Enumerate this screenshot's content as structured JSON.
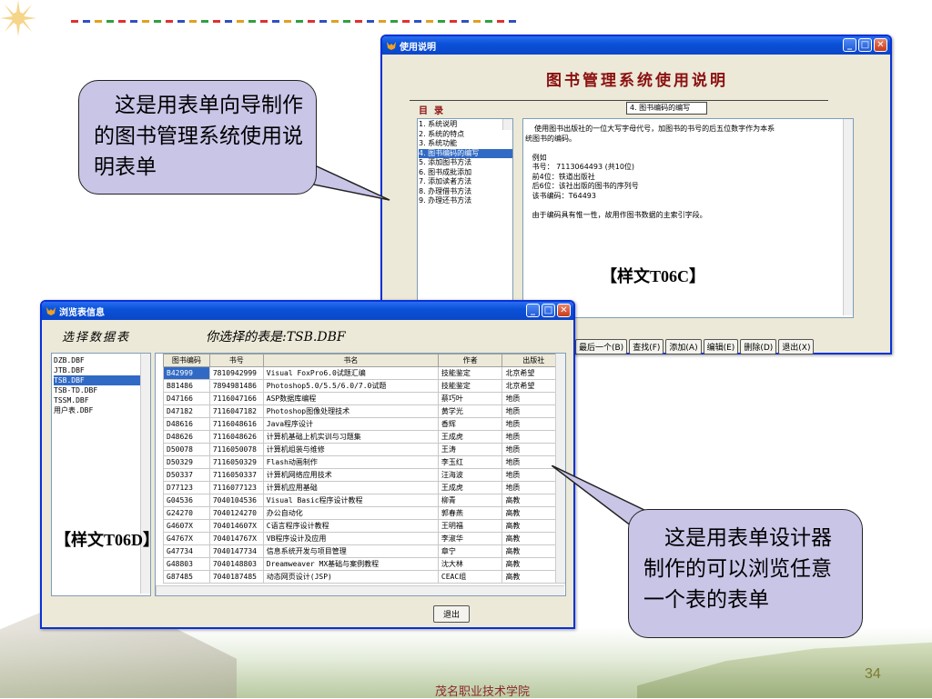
{
  "slide": {
    "page_number": "34",
    "footer": "茂名职业技术学院",
    "callout_left": "这是用表单向导制作的图书管理系统使用说明表单",
    "callout_right": "这是用表单设计器制作的可以浏览任意一个表的表单",
    "label_c": "【样文T06C】",
    "label_d": "【样文T06D】"
  },
  "help_window": {
    "title": "使用说明",
    "heading": "图书管理系统使用说明",
    "toc_label": "目  录",
    "tab_label": "4. 图书编码的编写",
    "toc_items": [
      "1. 系统说明",
      "2. 系统的特点",
      "3. 系统功能",
      "4. 图书编码的编写",
      "5. 添加图书方法",
      "6. 图书成批添加",
      "7. 添加读者方法",
      "8. 办理借书方法",
      "9. 办理还书方法"
    ],
    "content_lines": [
      "    使用图书出版社的一位大写字母代号，加图书的书号的后五位数字作为本系",
      "统图书的编码。",
      "",
      "   例如",
      "   书号： 7113064493 (共10位)",
      "   前4位：铁道出版社",
      "   后6位：该社出版的图书的序列号",
      "   该书编码：T64493",
      "",
      "   由于编码具有惟一性，故用作图书数据的主索引字段。"
    ],
    "buttons": [
      "最后一个(B)",
      "查找(F)",
      "添加(A)",
      "编辑(E)",
      "删除(D)",
      "退出(X)"
    ]
  },
  "browse_window": {
    "title": "浏览表信息",
    "select_label": "选择数据表",
    "chosen_label": "你选择的表是:",
    "chosen_value": "TSB.DBF",
    "tables": [
      "DZB.DBF",
      "JTB.DBF",
      "TSB.DBF",
      "TSB-TD.DBF",
      "TSSM.DBF",
      "用户表.DBF"
    ],
    "columns": [
      "图书编码",
      "书号",
      "书名",
      "作者",
      "出版社"
    ],
    "rows": [
      [
        "B42999",
        "7810942999",
        "Visual FoxPro6.0试题汇编",
        "技能鉴定",
        "北京希望"
      ],
      [
        "B81486",
        "7894981486",
        "Photoshop5.0/5.5/6.0/7.0试题",
        "技能鉴定",
        "北京希望"
      ],
      [
        "D47166",
        "7116047166",
        "ASP数据库编程",
        "蔡巧叶",
        "地质"
      ],
      [
        "D47182",
        "7116047182",
        "Photoshop图像处理技术",
        "黄学光",
        "地质"
      ],
      [
        "D48616",
        "7116048616",
        "Java程序设计",
        "香辉",
        "地质"
      ],
      [
        "D48626",
        "7116048626",
        "计算机基础上机实训与习题集",
        "王成虎",
        "地质"
      ],
      [
        "D50078",
        "7116050078",
        "计算机组装与维修",
        "王涛",
        "地质"
      ],
      [
        "D50329",
        "7116050329",
        "Flash动画制作",
        "李玉红",
        "地质"
      ],
      [
        "D50337",
        "7116050337",
        "计算机网络应用技术",
        "汪海波",
        "地质"
      ],
      [
        "D77123",
        "7116077123",
        "计算机应用基础",
        "王成虎",
        "地质"
      ],
      [
        "G04536",
        "7040104536",
        "Visual Basic程序设计教程",
        "柳青",
        "高教"
      ],
      [
        "G24270",
        "7040124270",
        "办公自动化",
        "郭春燕",
        "高教"
      ],
      [
        "G4607X",
        "704014607X",
        "C语言程序设计教程",
        "王明福",
        "高教"
      ],
      [
        "G4767X",
        "704014767X",
        "VB程序设计及应用",
        "李淑华",
        "高教"
      ],
      [
        "G47734",
        "7040147734",
        "信息系统开发与项目管理",
        "章宁",
        "高教"
      ],
      [
        "G48803",
        "7040148803",
        "Dreamweaver MX基础与案例教程",
        "沈大林",
        "高教"
      ],
      [
        "G87485",
        "7040187485",
        "动态网页设计(JSP)",
        "CEAC组",
        "高教"
      ]
    ],
    "exit_button": "退出"
  }
}
